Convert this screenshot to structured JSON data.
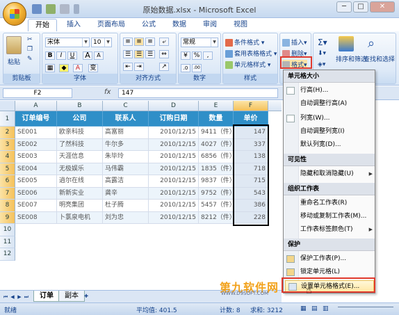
{
  "window": {
    "title": "原始数据.xlsx - Microsoft Excel",
    "minimize": "─",
    "maximize": "□",
    "close": "✕"
  },
  "tabs": [
    "开始",
    "插入",
    "页面布局",
    "公式",
    "数据",
    "审阅",
    "视图"
  ],
  "ribbon": {
    "clipboard": {
      "label": "剪贴板",
      "paste": "粘贴"
    },
    "font": {
      "label": "字体",
      "name": "宋体",
      "size": "10",
      "bold": "B",
      "italic": "I",
      "underline": "U",
      "grow": "A",
      "shrink": "A",
      "color_a": "A",
      "wen": "变"
    },
    "alignment": {
      "label": "对齐方式"
    },
    "number": {
      "label": "数字",
      "format": "常规",
      "pct": "%",
      "comma": ",",
      "inc": ".0",
      "dec": ".00"
    },
    "styles": {
      "label": "样式",
      "conditional": "条件格式",
      "table": "套用表格格式",
      "cell": "单元格样式"
    },
    "cells": {
      "insert": "插入",
      "delete": "删除",
      "format": "格式"
    },
    "editing": {
      "sort": "排序和筛选",
      "find": "查找和选择"
    }
  },
  "formula_bar": {
    "name_box": "F2",
    "fx": "fx",
    "value": "147"
  },
  "columns": [
    "A",
    "B",
    "C",
    "D",
    "E",
    "F"
  ],
  "rows": [
    "1",
    "2",
    "3",
    "4",
    "5",
    "6",
    "7",
    "8",
    "9",
    "10",
    "11",
    "12"
  ],
  "table": {
    "headers": [
      "订单编号",
      "公司",
      "联系人",
      "订购日期",
      "数量",
      "单价"
    ],
    "data": [
      [
        "SE001",
        "欧亲科技",
        "高富丽",
        "2010/12/15",
        "9411（件）",
        "147"
      ],
      [
        "SE002",
        "了然科技",
        "牛尔多",
        "2010/12/15",
        "4027（件）",
        "337"
      ],
      [
        "SE003",
        "天涯信息",
        "朱毕玲",
        "2010/12/15",
        "6856（件）",
        "138"
      ],
      [
        "SE004",
        "无极娱乐",
        "马伟霸",
        "2010/12/15",
        "1835（件）",
        "718"
      ],
      [
        "SE005",
        "逍尔在线",
        "高露洁",
        "2010/12/15",
        "9837（件）",
        "715"
      ],
      [
        "SE006",
        "新新实业",
        "龚辛",
        "2010/12/15",
        "9752（件）",
        "543"
      ],
      [
        "SE007",
        "明亮集团",
        "杜子腾",
        "2010/12/15",
        "5457（件）",
        "386"
      ],
      [
        "SE008",
        "卜氯泉电机",
        "刘为忠",
        "2010/12/15",
        "8212（件）",
        "228"
      ]
    ]
  },
  "sheets": [
    "订单",
    "副本"
  ],
  "status": {
    "ready": "就绪",
    "average": "平均值: 401.5",
    "count": "计数: 8",
    "sum": "求和: 3212"
  },
  "menu": {
    "sections": {
      "cell_size": "单元格大小",
      "visibility": "可见性",
      "organize": "组织工作表",
      "protect": "保护"
    },
    "items": {
      "row_height": "行高(H)...",
      "autofit_row": "自动调整行高(A)",
      "col_width": "列宽(W)...",
      "autofit_col": "自动调整列宽(I)",
      "default_width": "默认列宽(D)...",
      "hide_unhide": "隐藏和取消隐藏(U)",
      "rename": "重命名工作表(R)",
      "move_copy": "移动或复制工作表(M)...",
      "tab_color": "工作表标签颜色(T)",
      "protect_sheet": "保护工作表(P)...",
      "lock_cell": "锁定单元格(L)",
      "format_cells": "设置单元格格式(E)..."
    }
  },
  "watermark": {
    "main": "第九软件网",
    "sub": "WWW.D9SOFT.COM"
  },
  "colors": {
    "header_blue": "#2f8fc8",
    "highlight_red": "#e03a2e",
    "selection_gold": "#f5c15a"
  }
}
